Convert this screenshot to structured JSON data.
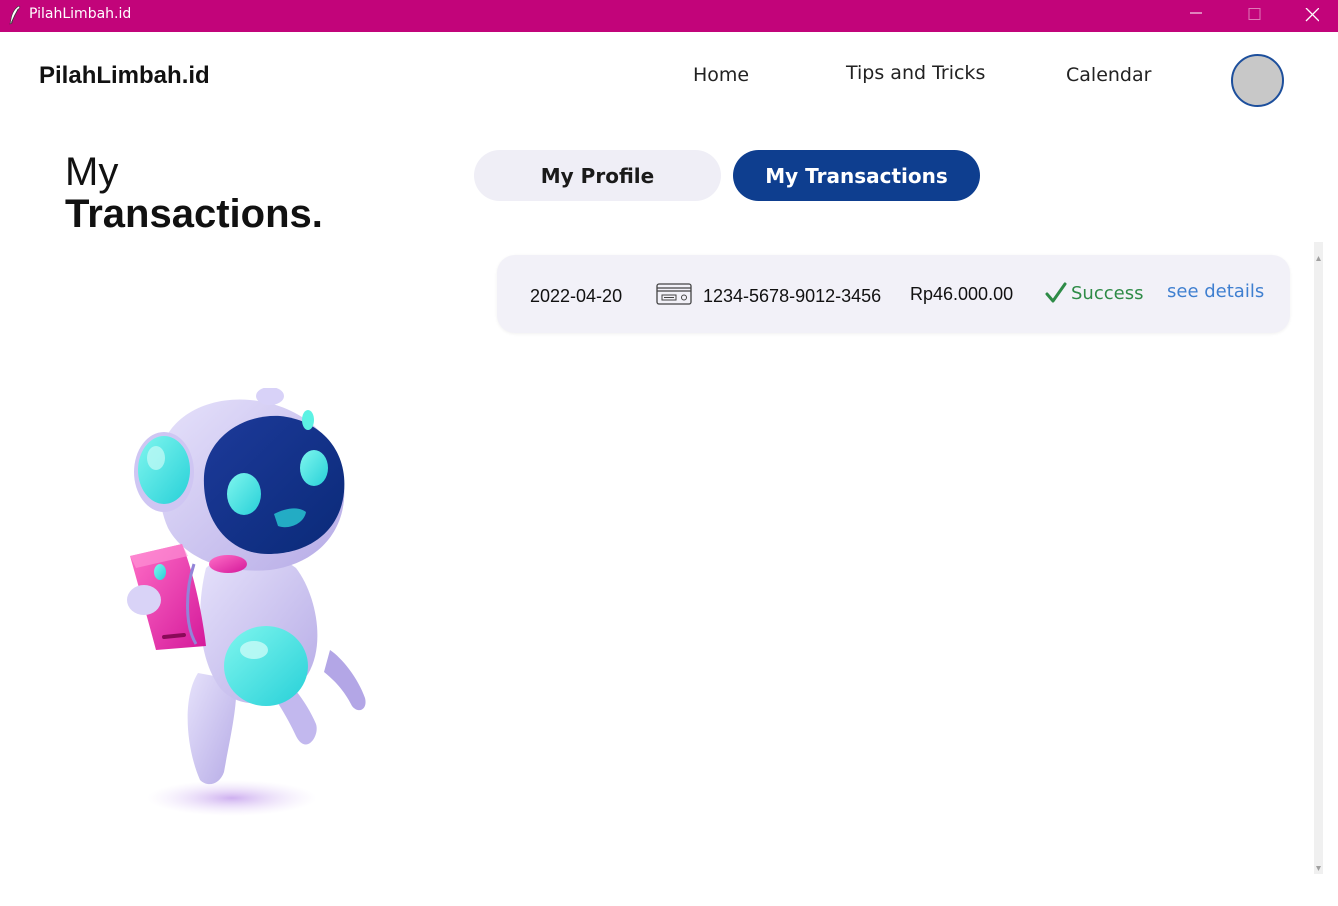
{
  "window": {
    "title": "PilahLimbah.id",
    "accent_color": "#c2047a"
  },
  "header": {
    "brand": "PilahLimbah.id",
    "nav": [
      {
        "label": "Home"
      },
      {
        "label": "Tips and Tricks"
      },
      {
        "label": "Calendar"
      }
    ],
    "avatar_icon": "user-avatar"
  },
  "page": {
    "heading_line1": "My",
    "heading_line2": "Transactions.",
    "illustration": "robot-holding-phone"
  },
  "tabs": [
    {
      "label": "My Profile",
      "active": false
    },
    {
      "label": "My Transactions",
      "active": true,
      "color": "#0e3e8f"
    }
  ],
  "transactions": [
    {
      "date": "2022-04-20",
      "payment_icon": "credit-card-icon",
      "card_number": "1234-5678-9012-3456",
      "amount": "Rp46.000.00",
      "status_icon": "checkmark-icon",
      "status": "Success",
      "details_link": "see details"
    }
  ]
}
